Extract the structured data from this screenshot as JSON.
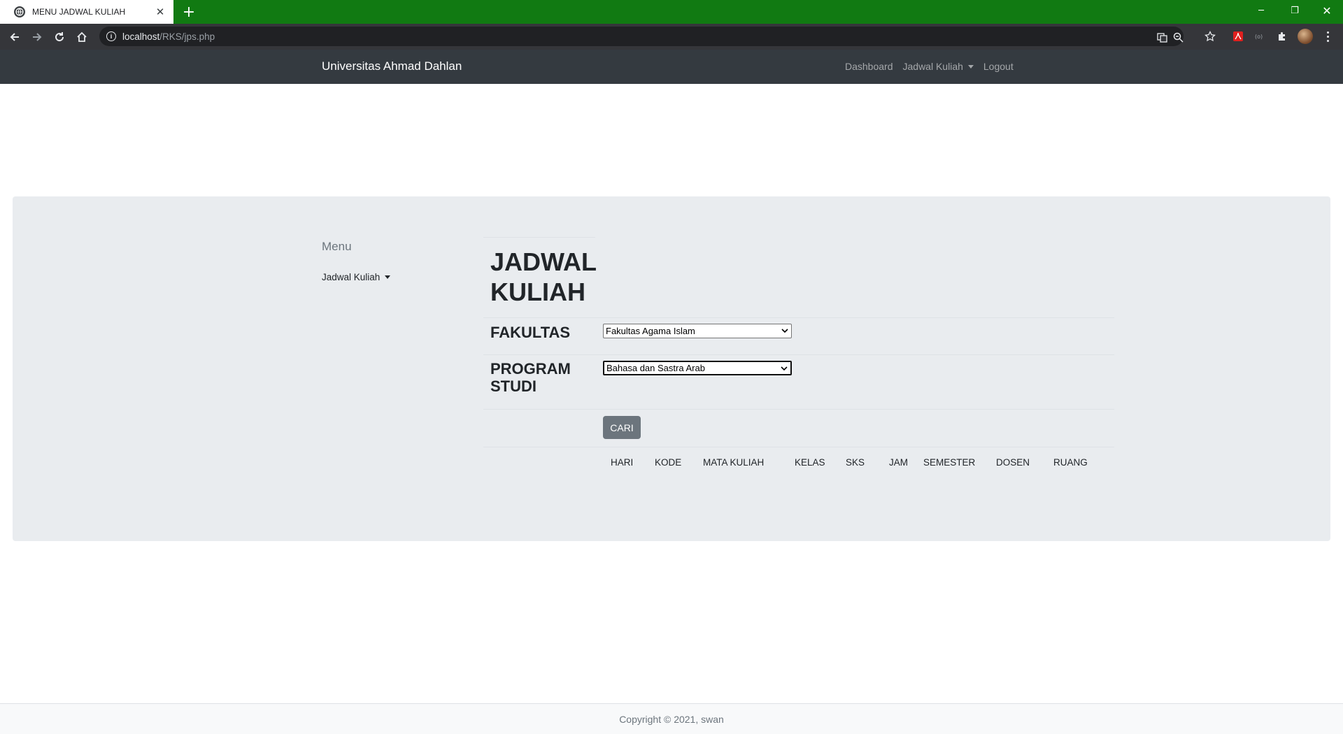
{
  "browser": {
    "tab_title": "MENU JADWAL KULIAH",
    "tab_close": "✕",
    "new_tab": "+",
    "url_host": "localhost",
    "url_path": "/RKS/jps.php",
    "window_controls": {
      "minimize": "─",
      "restore": "❐",
      "close": "✕"
    },
    "icons": [
      "back-icon",
      "forward-icon",
      "reload-icon",
      "home-icon",
      "info-icon",
      "translate-icon",
      "zoom-icon",
      "star-icon",
      "pdf-extension-icon",
      "extension-icon",
      "puzzle-icon",
      "profile-avatar",
      "menu-icon"
    ]
  },
  "navbar": {
    "brand": "Universitas Ahmad Dahlan",
    "links": {
      "dashboard": "Dashboard",
      "jadwal": "Jadwal Kuliah",
      "logout": "Logout"
    },
    "background": "#343a40"
  },
  "sidebar": {
    "title": "Menu",
    "item": "Jadwal Kuliah"
  },
  "main": {
    "title_line1": "JADWAL",
    "title_line2": "KULIAH",
    "fakultas_label": "FAKULTAS",
    "fakultas_selected": "Fakultas Agama Islam",
    "prodi_label_line1": "PROGRAM",
    "prodi_label_line2": "STUDI",
    "prodi_selected": "Bahasa dan Sastra Arab",
    "button": "CARI",
    "table_headers": [
      "HARI",
      "KODE",
      "MATA KULIAH",
      "KELAS",
      "SKS",
      "JAM",
      "SEMESTER",
      "DOSEN",
      "RUANG"
    ]
  },
  "footer": {
    "copyright": "Copyright © 2021, swan"
  },
  "colors": {
    "tabbar": "#117a12",
    "toolbar": "#35363a",
    "jumbotron": "#e9ecef",
    "button": "#6c757d"
  }
}
